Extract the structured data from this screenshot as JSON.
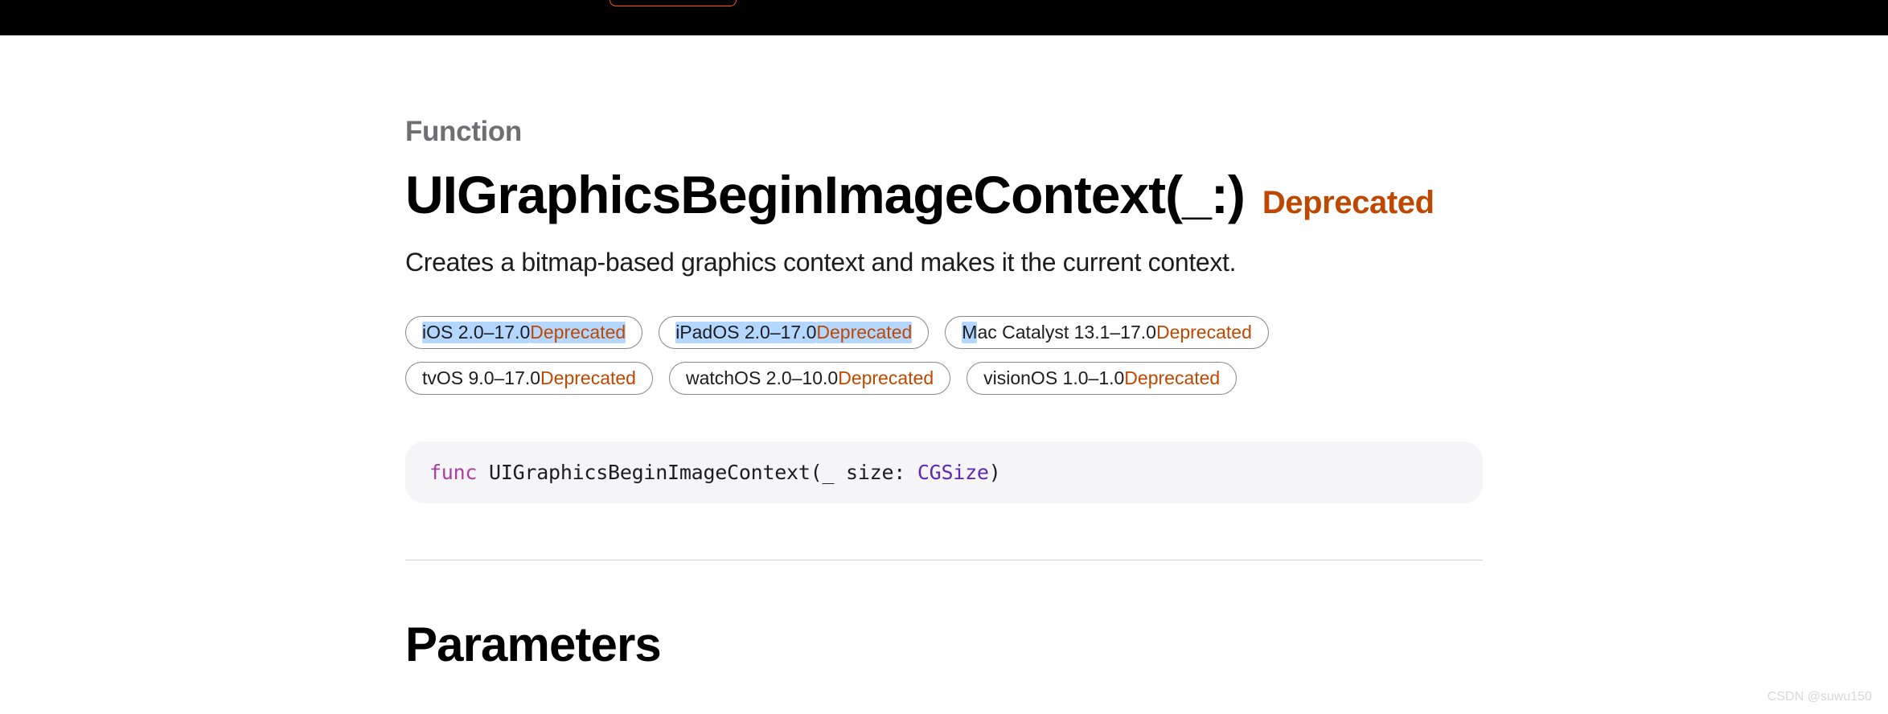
{
  "eyebrow": "Function",
  "title": "UIGraphicsBeginImageContext(_:)",
  "title_badge": "Deprecated",
  "description": "Creates a bitmap-based graphics context and makes it the current context.",
  "pills": [
    {
      "highlighted_prefix": "iOS 2.0–17.0 ",
      "normal": "",
      "deprecated_highlighted": "Deprecated",
      "deprecated_plain": ""
    },
    {
      "highlighted_prefix": "iPadOS 2.0–17.0 ",
      "normal": "",
      "deprecated_highlighted": "Deprecated",
      "deprecated_plain": ""
    },
    {
      "highlighted_prefix": "M",
      "normal": "ac Catalyst 13.1–17.0 ",
      "deprecated_highlighted": "",
      "deprecated_plain": "Deprecated"
    },
    {
      "highlighted_prefix": "",
      "normal": "tvOS 9.0–17.0 ",
      "deprecated_highlighted": "",
      "deprecated_plain": "Deprecated"
    },
    {
      "highlighted_prefix": "",
      "normal": "watchOS 2.0–10.0 ",
      "deprecated_highlighted": "",
      "deprecated_plain": "Deprecated"
    },
    {
      "highlighted_prefix": "",
      "normal": "visionOS 1.0–1.0 ",
      "deprecated_highlighted": "",
      "deprecated_plain": "Deprecated"
    }
  ],
  "code": {
    "keyword": "func",
    "name": " UIGraphicsBeginImageContext(_ size: ",
    "type": "CGSize",
    "tail": ")"
  },
  "section_heading": "Parameters",
  "watermark": "CSDN @suwu150"
}
